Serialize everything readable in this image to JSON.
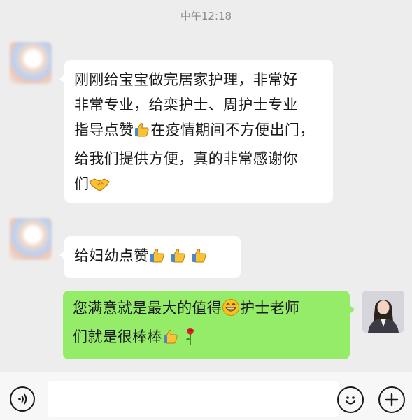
{
  "timestamp": "中午12:18",
  "messages": [
    {
      "id": "m1",
      "direction": "incoming",
      "lines": [
        [
          "刚刚给宝宝做完居家护理，非常好"
        ],
        [
          "非常专业，给栾护士、周护士专业"
        ],
        [
          "指导点赞",
          "thumbs-up-icon",
          "在疫情期间不方便出门，"
        ],
        [
          "给我们提供方便，真的非常感谢你"
        ],
        [
          "们",
          "handshake-icon"
        ]
      ]
    },
    {
      "id": "m2",
      "direction": "incoming",
      "text": "给妇幼点赞",
      "emojis": [
        "thumbs-up-icon",
        "thumbs-up-icon",
        "thumbs-up-icon"
      ]
    },
    {
      "id": "m3",
      "direction": "outgoing",
      "line1": "您满意就是最大的值得",
      "line1_emoji": "grinning-face-icon",
      "line1_after": "护士老师",
      "line2": "们就是很棒棒",
      "line2_emojis": [
        "thumbs-up-icon",
        "rose-icon"
      ]
    }
  ],
  "input_bar": {
    "voice_icon": "voice-icon",
    "emoji_icon": "smiley-icon",
    "more_icon": "plus-icon",
    "input_value": ""
  },
  "colors": {
    "background": "#ededed",
    "incoming_bubble": "#ffffff",
    "outgoing_bubble": "#95ec69",
    "timestamp": "#8a8a8a"
  }
}
